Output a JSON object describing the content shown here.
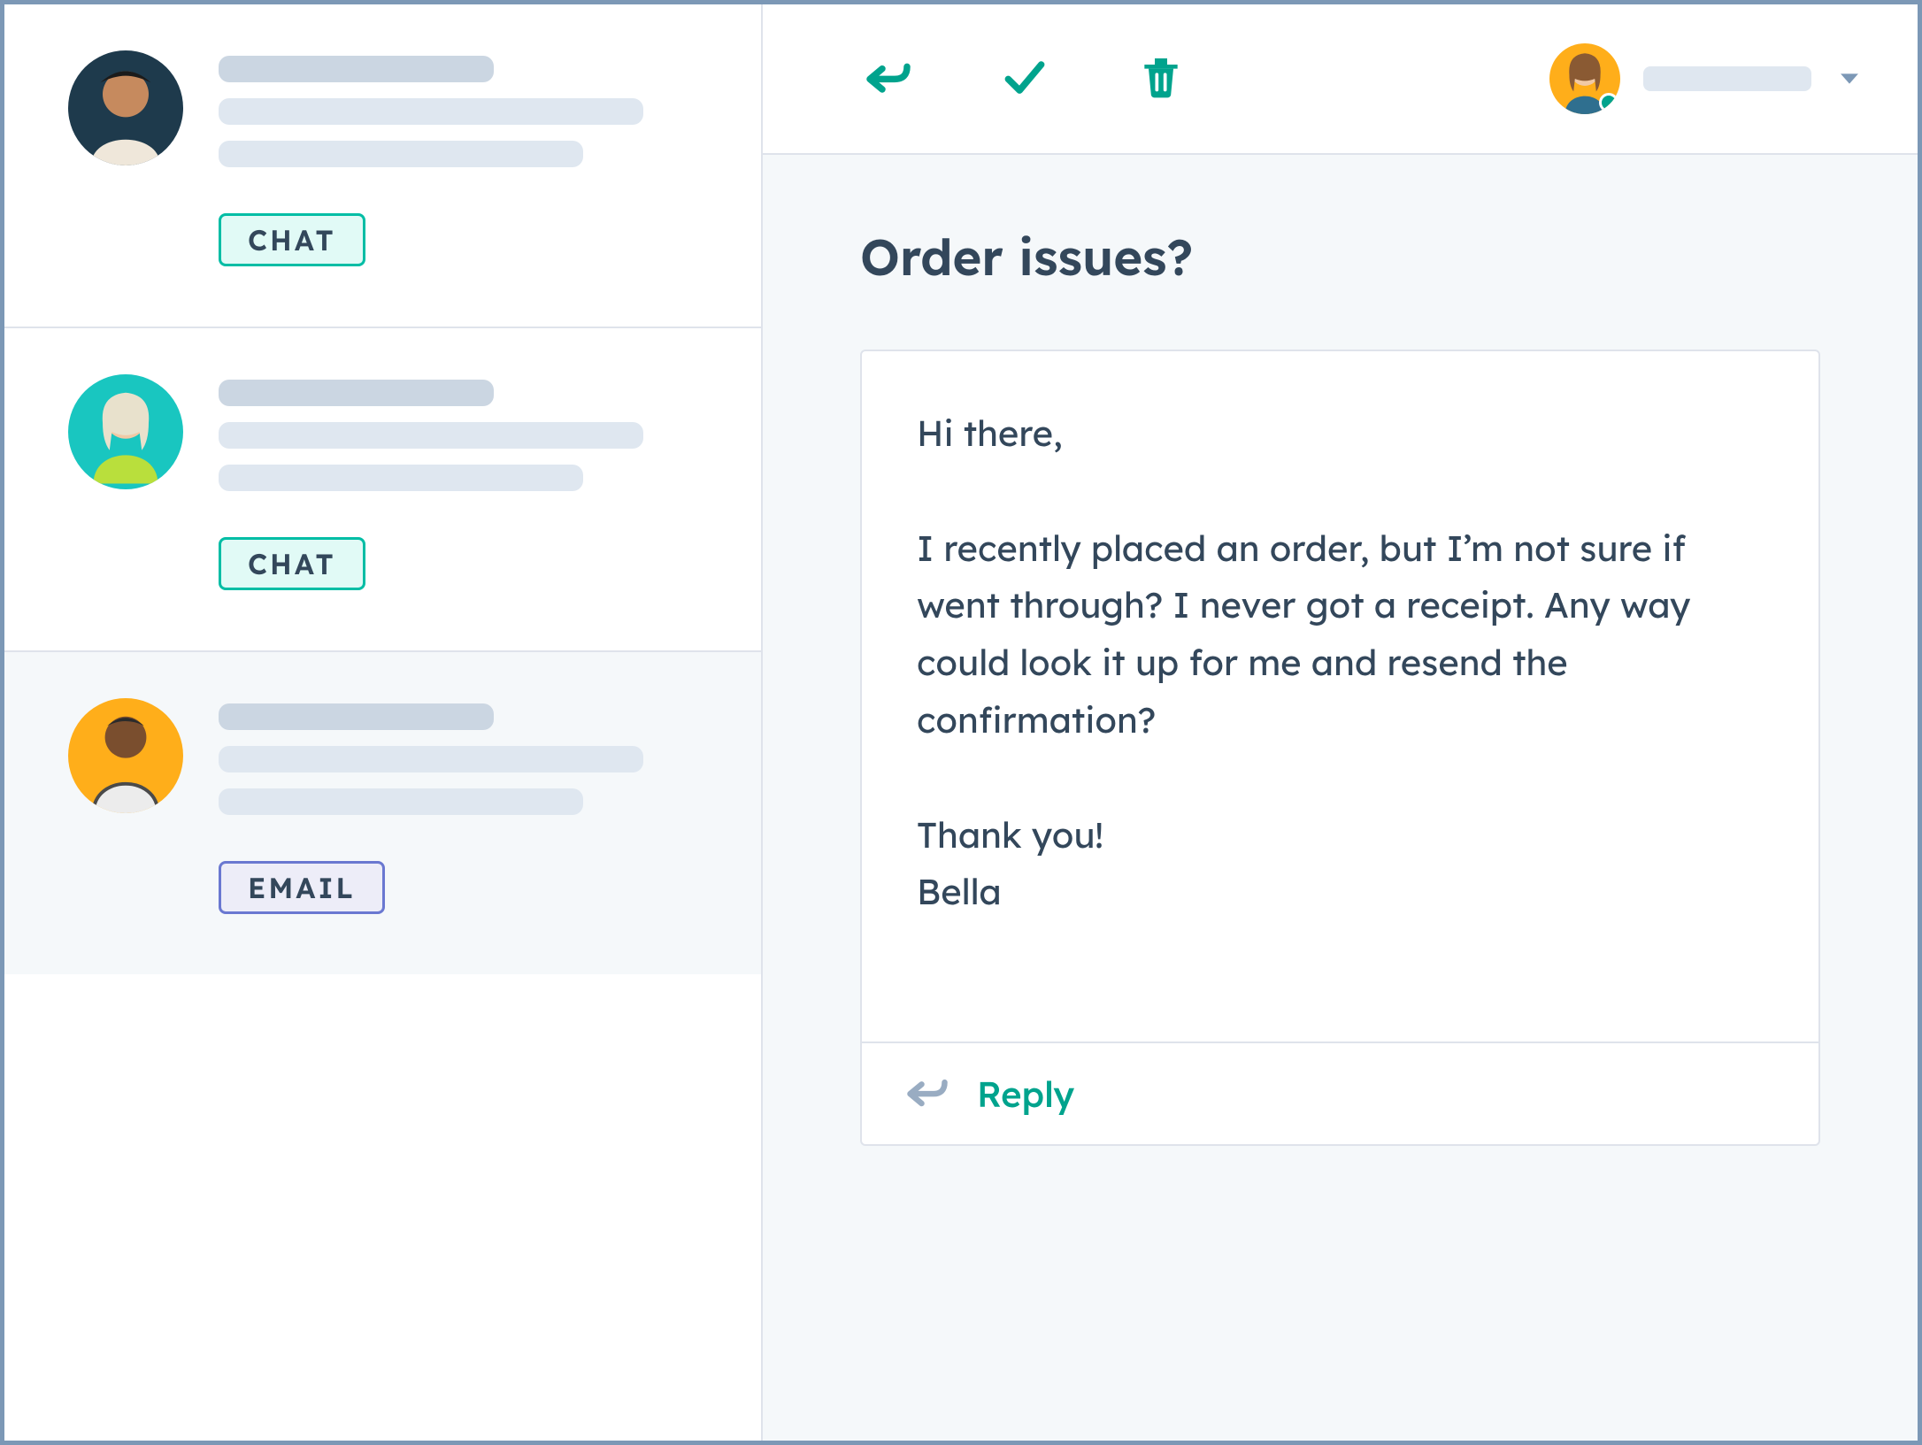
{
  "inbox": {
    "items": [
      {
        "channel": "CHAT",
        "selected": false
      },
      {
        "channel": "CHAT",
        "selected": false
      },
      {
        "channel": "EMAIL",
        "selected": true
      }
    ]
  },
  "toolbar": {
    "icons": {
      "reply": "reply-icon",
      "done": "check-icon",
      "trash": "trash-icon"
    },
    "assignee": {
      "status": "online"
    }
  },
  "thread": {
    "subject": "Order issues?",
    "message": "Hi there,\n\nI recently placed an order, but I’m not sure if went through? I never got a receipt. Any way could look it up for me and resend the confirmation?\n\nThank you!\nBella",
    "reply_label": "Reply"
  }
}
